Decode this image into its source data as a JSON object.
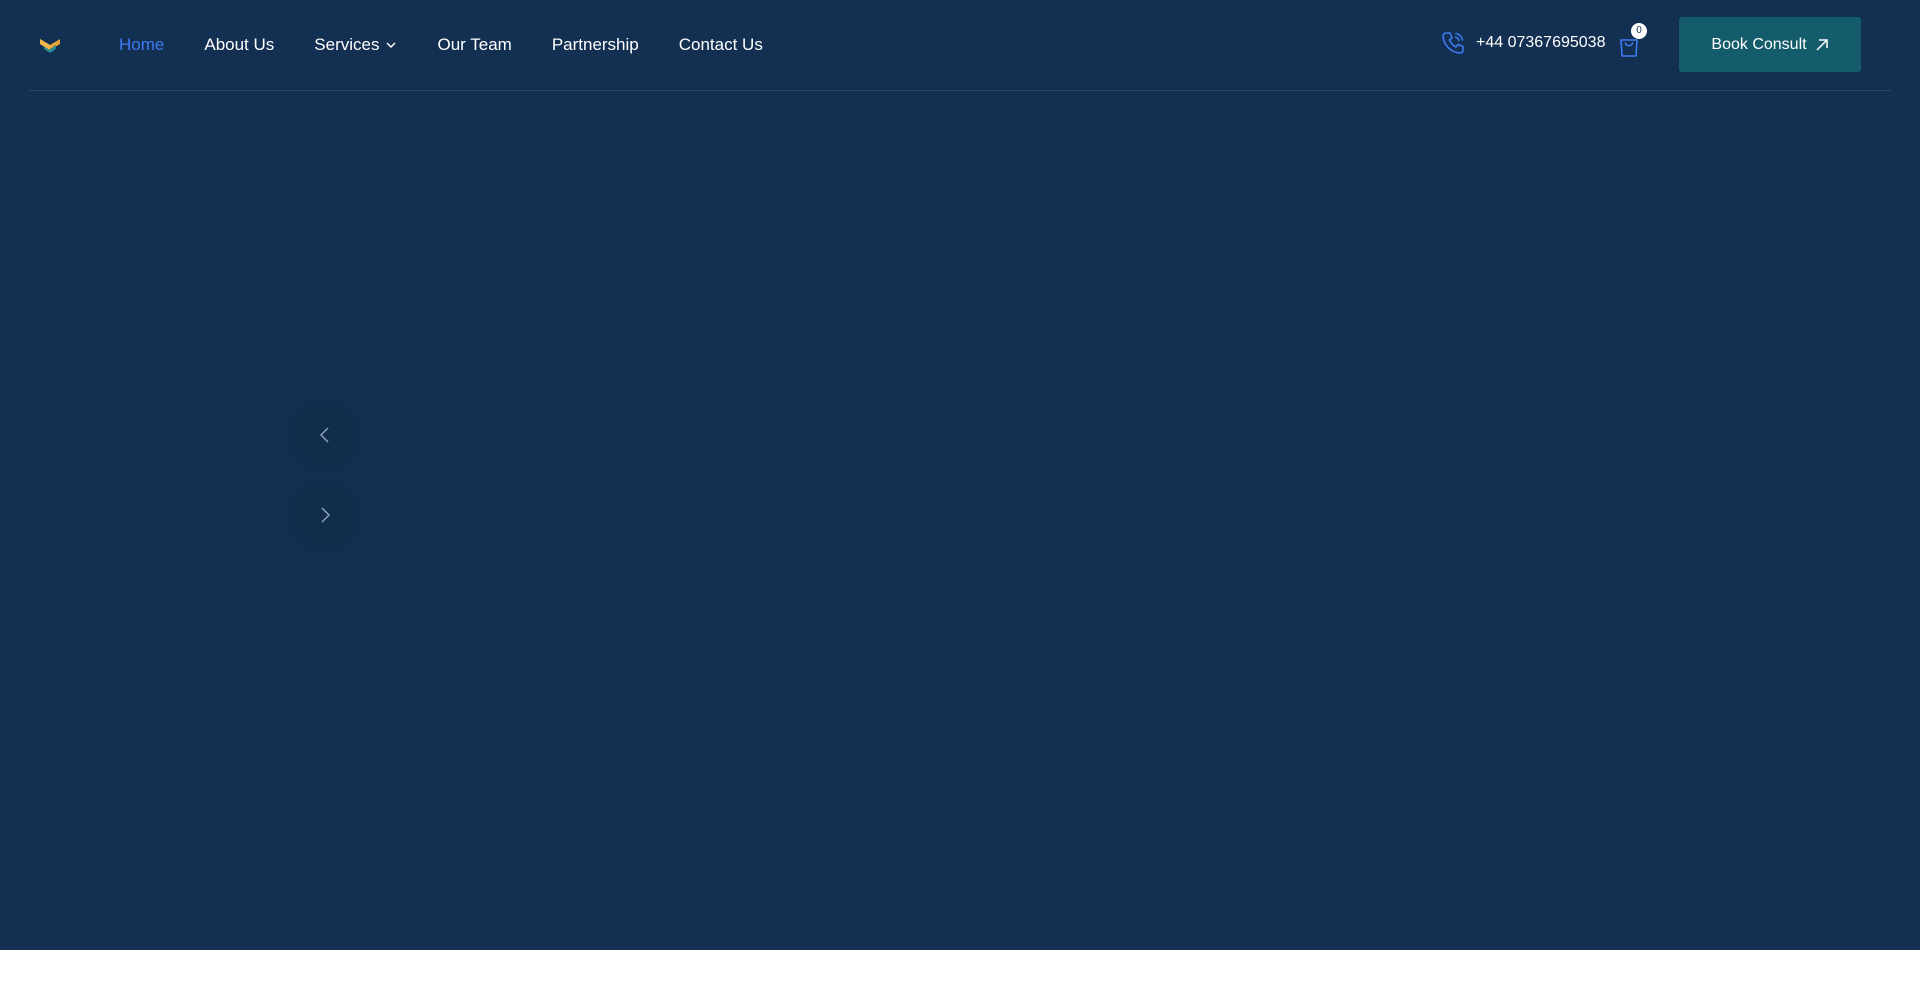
{
  "nav": {
    "items": [
      {
        "label": "Home",
        "active": true
      },
      {
        "label": "About Us"
      },
      {
        "label": "Services",
        "has_dropdown": true
      },
      {
        "label": "Our Team"
      },
      {
        "label": "Partnership"
      },
      {
        "label": "Contact Us"
      }
    ]
  },
  "contact": {
    "phone": "+44 07367695038"
  },
  "cart": {
    "count": "0"
  },
  "cta": {
    "label": "Book Consult"
  },
  "slider": {
    "prev_icon": "chevron-left-icon",
    "next_icon": "chevron-right-icon"
  },
  "colors": {
    "background": "#132f51",
    "accent": "#3d7bf2",
    "button": "#145b6c",
    "logo_orange": "#e8a43b",
    "logo_teal": "#2a8a8f"
  }
}
